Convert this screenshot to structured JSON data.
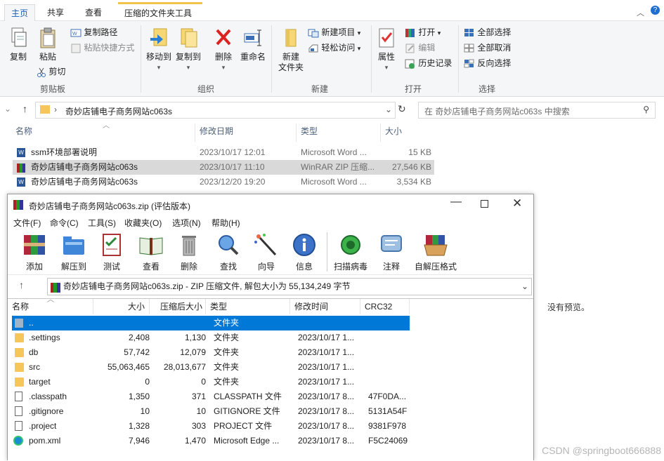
{
  "ribbon": {
    "tabs": [
      {
        "label": "主页"
      },
      {
        "label": "共享"
      },
      {
        "label": "查看"
      },
      {
        "label": "压缩的文件夹工具"
      }
    ],
    "clipboard": {
      "copy": "复制",
      "paste": "粘贴",
      "copy_path": "复制路径",
      "paste_shortcut": "粘贴快捷方式",
      "cut": "剪切",
      "group": "剪贴板"
    },
    "organize": {
      "move_to": "移动到",
      "copy_to": "复制到",
      "delete": "删除",
      "rename": "重命名",
      "group": "组织"
    },
    "new": {
      "new_folder_line1": "新建",
      "new_folder_line2": "文件夹",
      "new_item": "新建项目",
      "easy_access": "轻松访问",
      "group": "新建"
    },
    "open": {
      "properties": "属性",
      "open": "打开",
      "edit": "编辑",
      "history": "历史记录",
      "group": "打开"
    },
    "select": {
      "select_all": "全部选择",
      "select_none": "全部取消",
      "invert": "反向选择",
      "group": "选择"
    }
  },
  "address": {
    "path": "奇妙店铺电子商务网站c063s",
    "search_placeholder": "在 奇妙店铺电子商务网站c063s 中搜索"
  },
  "columns": {
    "name": "名称",
    "date": "修改日期",
    "type": "类型",
    "size": "大小"
  },
  "files": [
    {
      "name": "ssm环境部署说明",
      "date": "2023/10/17 12:01",
      "type": "Microsoft Word ...",
      "size": "15 KB",
      "icon": "word-icon"
    },
    {
      "name": "奇妙店铺电子商务网站c063s",
      "date": "2023/10/17 11:10",
      "type": "WinRAR ZIP 压缩...",
      "size": "27,546 KB",
      "icon": "winrar-icon"
    },
    {
      "name": "奇妙店铺电子商务网站c063s",
      "date": "2023/12/20 19:20",
      "type": "Microsoft Word ...",
      "size": "3,534 KB",
      "icon": "word-icon"
    }
  ],
  "preview_text": "没有预览。",
  "watermark": "CSDN @springboot666888",
  "winrar": {
    "title": "奇妙店铺电子商务网站c063s.zip (评估版本)",
    "menu": [
      "文件(F)",
      "命令(C)",
      "工具(S)",
      "收藏夹(O)",
      "选项(N)",
      "帮助(H)"
    ],
    "toolbar": [
      "添加",
      "解压到",
      "测试",
      "查看",
      "删除",
      "查找",
      "向导",
      "信息",
      "扫描病毒",
      "注释",
      "自解压格式"
    ],
    "path": "奇妙店铺电子商务网站c063s.zip - ZIP 压缩文件, 解包大小为 55,134,249 字节",
    "columns": {
      "name": "名称",
      "size": "大小",
      "packed": "压缩后大小",
      "type": "类型",
      "modified": "修改时间",
      "crc": "CRC32"
    },
    "rows": [
      {
        "name": "..",
        "size": "",
        "packed": "",
        "type": "文件夹",
        "modified": "",
        "crc": "",
        "kind": "up"
      },
      {
        "name": ".settings",
        "size": "2,408",
        "packed": "1,130",
        "type": "文件夹",
        "modified": "2023/10/17 1...",
        "crc": "",
        "kind": "folder"
      },
      {
        "name": "db",
        "size": "57,742",
        "packed": "12,079",
        "type": "文件夹",
        "modified": "2023/10/17 1...",
        "crc": "",
        "kind": "folder"
      },
      {
        "name": "src",
        "size": "55,063,465",
        "packed": "28,013,677",
        "type": "文件夹",
        "modified": "2023/10/17 1...",
        "crc": "",
        "kind": "folder"
      },
      {
        "name": "target",
        "size": "0",
        "packed": "0",
        "type": "文件夹",
        "modified": "2023/10/17 1...",
        "crc": "",
        "kind": "folder"
      },
      {
        "name": ".classpath",
        "size": "1,350",
        "packed": "371",
        "type": "CLASSPATH 文件",
        "modified": "2023/10/17 8...",
        "crc": "47F0DA...",
        "kind": "file"
      },
      {
        "name": ".gitignore",
        "size": "10",
        "packed": "10",
        "type": "GITIGNORE 文件",
        "modified": "2023/10/17 8...",
        "crc": "5131A54F",
        "kind": "file"
      },
      {
        "name": ".project",
        "size": "1,328",
        "packed": "303",
        "type": "PROJECT 文件",
        "modified": "2023/10/17 8...",
        "crc": "9381F978",
        "kind": "file"
      },
      {
        "name": "pom.xml",
        "size": "7,946",
        "packed": "1,470",
        "type": "Microsoft Edge ...",
        "modified": "2023/10/17 8...",
        "crc": "F5C24069",
        "kind": "edge"
      }
    ]
  }
}
